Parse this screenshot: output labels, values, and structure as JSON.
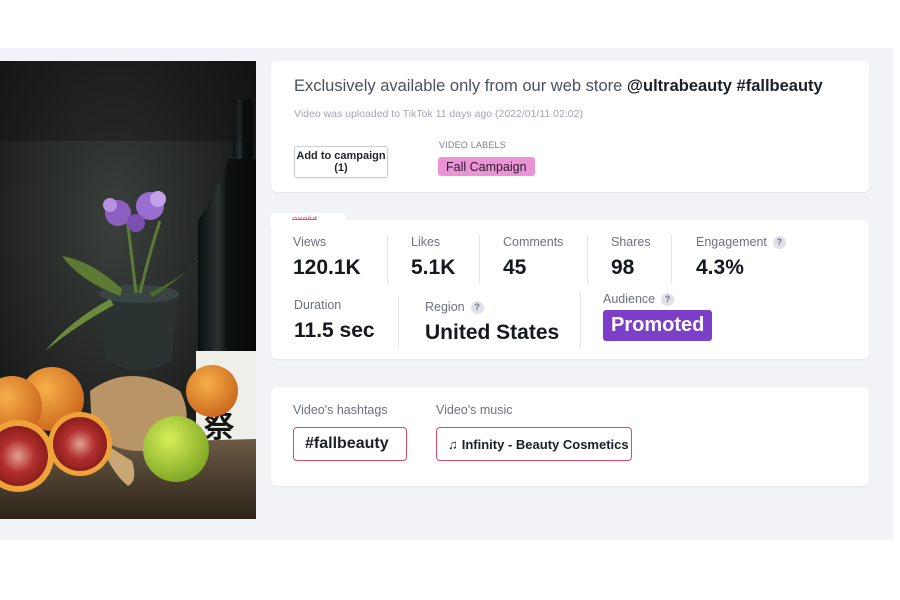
{
  "post": {
    "caption_text": "Exclusively available only from our web store ",
    "caption_mentions": "@ultrabeauty #fallbeauty",
    "upload_info": "Video was uploaded to TikTok 11 days ago (2022/01/11 02:02)",
    "campaign_button": "Add to campaign (1)",
    "labels_title": "VIDEO LABELS",
    "label": "Fall Campaign",
    "label_color": "#ea94d6"
  },
  "watermark": "exolyt",
  "stats": {
    "views": {
      "label": "Views",
      "value": "120.1K"
    },
    "likes": {
      "label": "Likes",
      "value": "5.1K"
    },
    "comments": {
      "label": "Comments",
      "value": "45"
    },
    "shares": {
      "label": "Shares",
      "value": "98"
    },
    "engagement": {
      "label": "Engagement",
      "value": "4.3%"
    },
    "duration": {
      "label": "Duration",
      "value": "11.5 sec"
    },
    "region": {
      "label": "Region",
      "value": "United States"
    },
    "audience": {
      "label": "Audience",
      "value": "Promoted",
      "color": "#7d3fc9"
    },
    "help_glyph": "?"
  },
  "tags": {
    "hashtags_title": "Video's hashtags",
    "hashtag": "#fallbeauty",
    "music_title": "Video's music",
    "music_glyph": "♫",
    "music": "Infinity - Beauty Cosmetics",
    "border_color": "#d64a6a"
  },
  "icons": [
    "help-icon",
    "music-note-icon"
  ]
}
